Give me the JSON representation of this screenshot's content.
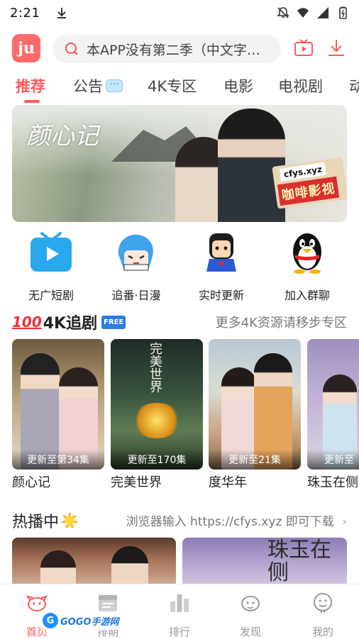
{
  "status_bar": {
    "time": "2:21",
    "icons": [
      "download-icon",
      "mute-icon",
      "wifi-icon",
      "signal-icon",
      "battery-icon"
    ]
  },
  "header": {
    "logo_text": "ju",
    "search_placeholder": "本APP没有第二季（中文字…",
    "buttons": [
      "tv-play-icon",
      "download-icon"
    ]
  },
  "tabs": [
    {
      "label": "推荐",
      "active": true
    },
    {
      "label": "公告",
      "active": false
    },
    {
      "label": "4K专区",
      "active": false
    },
    {
      "label": "电影",
      "active": false
    },
    {
      "label": "电视剧",
      "active": false
    },
    {
      "label": "动",
      "active": false
    }
  ],
  "banner": {
    "calligraphy": "颜心记",
    "ad_url": "cfys.xyz",
    "ad_title": "咖啡影视"
  },
  "quick_links": [
    {
      "label": "无广短剧",
      "icon": "tv-icon"
    },
    {
      "label": "追番·日漫",
      "icon": "anime-icon"
    },
    {
      "label": "实时更新",
      "icon": "hero-icon"
    },
    {
      "label": "加入群聊",
      "icon": "qq-penguin-icon"
    }
  ],
  "section_4k": {
    "badge": "100",
    "title": "4K追剧",
    "free_badge": "FREE",
    "more": "更多4K资源请移步专区",
    "items": [
      {
        "title": "颜心记",
        "caption": "更新至第34集"
      },
      {
        "title": "完美世界",
        "caption": "更新至170集"
      },
      {
        "title": "度华年",
        "caption": "更新至21集"
      },
      {
        "title": "珠玉在侧",
        "caption": "更新至"
      }
    ]
  },
  "section_hot": {
    "title": "热播中",
    "notice": "浏览器输入 https://cfys.xyz 即可下载",
    "hot_poster_text": "珠玉在侧"
  },
  "bottom_nav": [
    {
      "label": "首页",
      "icon": "home-icon",
      "active": true
    },
    {
      "label": "排期",
      "icon": "calendar-icon",
      "active": false
    },
    {
      "label": "排行",
      "icon": "ranking-icon",
      "active": false
    },
    {
      "label": "发现",
      "icon": "discover-icon",
      "active": false
    },
    {
      "label": "我的",
      "icon": "profile-icon",
      "active": false
    }
  ],
  "watermark": {
    "logo": "G",
    "text": "GOGO手游网"
  },
  "colors": {
    "accent": "#ff5a5a",
    "text": "#222222",
    "muted": "#999999",
    "search_bg": "#f3f3f3"
  }
}
